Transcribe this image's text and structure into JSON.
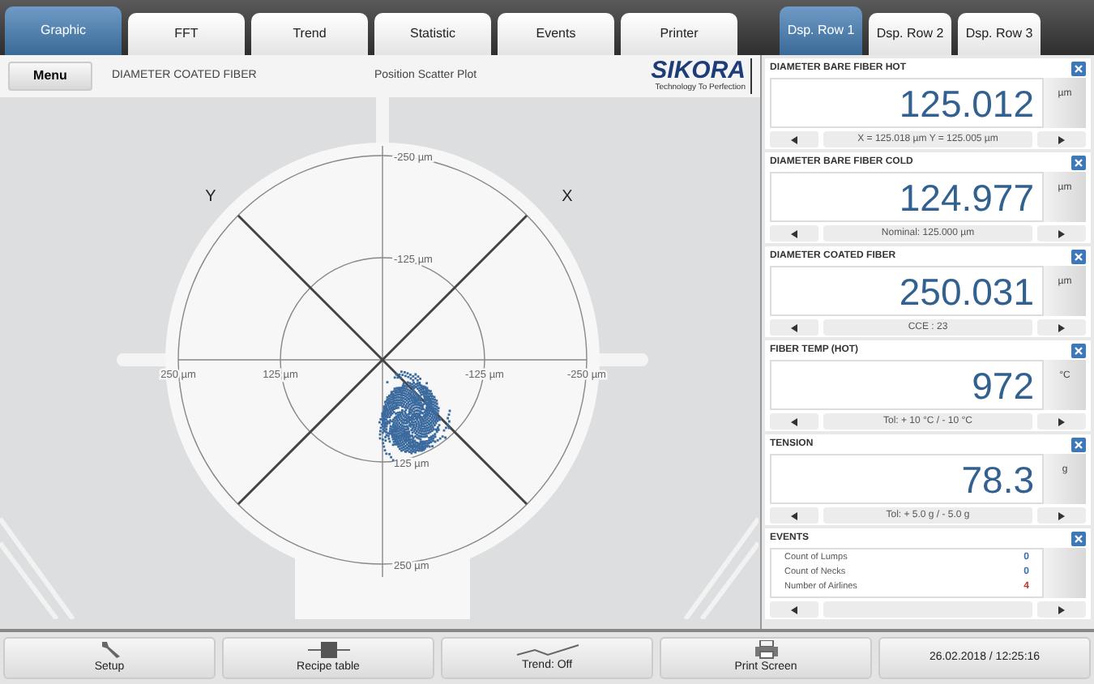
{
  "tabs": [
    {
      "label": "Graphic",
      "selected": true
    },
    {
      "label": "FFT",
      "selected": false
    },
    {
      "label": "Trend",
      "selected": false
    },
    {
      "label": "Statistic",
      "selected": false
    },
    {
      "label": "Events",
      "selected": false
    },
    {
      "label": "Printer",
      "selected": false
    }
  ],
  "row_tabs": [
    {
      "label": "Dsp. Row 1",
      "selected": true
    },
    {
      "label": "Dsp. Row 2",
      "selected": false
    },
    {
      "label": "Dsp. Row 3",
      "selected": false
    }
  ],
  "plot_header": {
    "menu_button": "Menu",
    "title": "DIAMETER COATED FIBER",
    "subtitle": "Position Scatter Plot",
    "logo": "SIKORA",
    "logo_tagline": "Technology To Perfection"
  },
  "plot": {
    "axis_y_letter": "Y",
    "axis_x_letter": "X",
    "top_labels": [
      "-250 µm",
      "-125 µm"
    ],
    "left_labels": [
      "250 µm",
      "125 µm"
    ],
    "right_labels": [
      "-125 µm",
      "-250 µm"
    ],
    "bottom_labels": [
      "125 µm",
      "250 µm"
    ]
  },
  "displays": [
    {
      "kind": "value",
      "title": "DIAMETER BARE FIBER HOT",
      "value": "125.012",
      "unit": "µm",
      "info": "X = 125.018 µm  Y = 125.005 µm"
    },
    {
      "kind": "value",
      "title": "DIAMETER BARE FIBER COLD",
      "value": "124.977",
      "unit": "µm",
      "info": "Nominal: 125.000 µm"
    },
    {
      "kind": "value",
      "title": "DIAMETER COATED FIBER",
      "value": "250.031",
      "unit": "µm",
      "info": "CCE : 23"
    },
    {
      "kind": "value",
      "title": "FIBER TEMP (HOT)",
      "value": "972",
      "unit": "°C",
      "info": "Tol: + 10 °C / - 10 °C"
    },
    {
      "kind": "value",
      "title": "TENSION",
      "value": "78.3",
      "unit": "g",
      "info": "Tol: + 5.0 g / - 5.0 g"
    },
    {
      "kind": "events",
      "title": "EVENTS",
      "rows": [
        {
          "label": "Count of Lumps",
          "count": "0",
          "color": "#3a6ea5"
        },
        {
          "label": "Count of Necks",
          "count": "0",
          "color": "#3a6ea5"
        },
        {
          "label": "Number of Airlines",
          "count": "4",
          "color": "#c0392b"
        }
      ]
    }
  ],
  "bottom_buttons": [
    {
      "kind": "wrench",
      "label": "Setup"
    },
    {
      "kind": "table",
      "label": "Recipe table"
    },
    {
      "kind": "trend",
      "label": "Trend: Off"
    },
    {
      "kind": "printer",
      "label": "Print Screen"
    },
    {
      "kind": "text",
      "label": "26.02.2018 / 12:25:16"
    }
  ]
}
